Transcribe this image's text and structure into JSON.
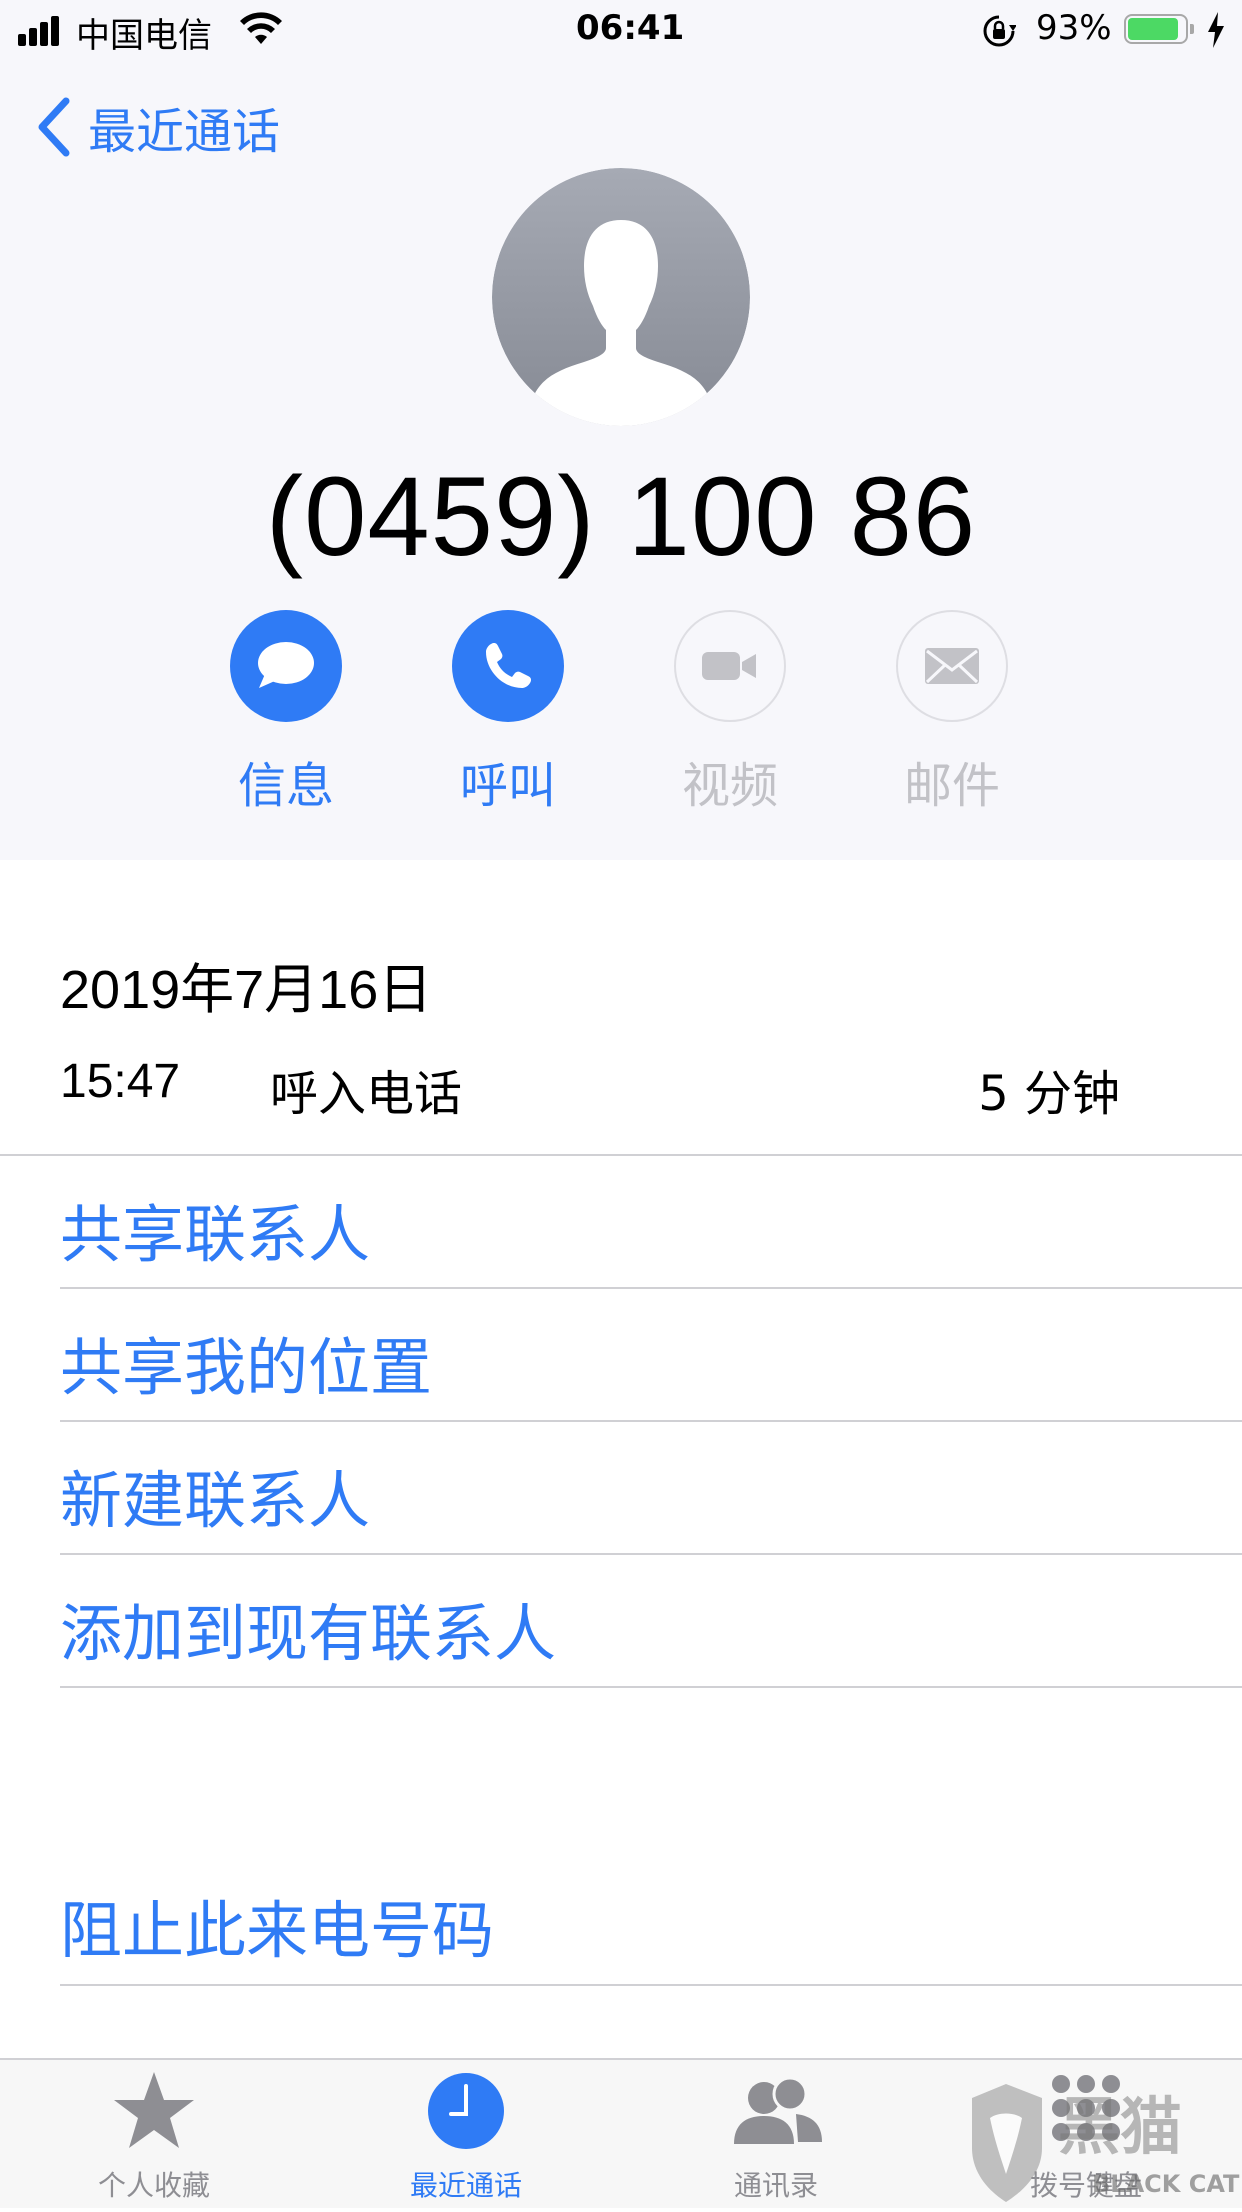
{
  "status_bar": {
    "carrier": "中国电信",
    "time": "06:41",
    "battery_percent": "93%",
    "battery_level": 0.93
  },
  "header": {
    "back_label": "最近通话",
    "phone_number": "(0459) 100 86",
    "actions": [
      {
        "label": "信息",
        "icon": "message-icon",
        "enabled": true
      },
      {
        "label": "呼叫",
        "icon": "phone-icon",
        "enabled": true
      },
      {
        "label": "视频",
        "icon": "video-icon",
        "enabled": false
      },
      {
        "label": "邮件",
        "icon": "mail-icon",
        "enabled": false
      }
    ]
  },
  "call_log": {
    "date": "2019年7月16日",
    "time": "15:47",
    "type": "呼入电话",
    "duration": "5 分钟"
  },
  "menu": {
    "share_contact": "共享联系人",
    "share_location": "共享我的位置",
    "new_contact": "新建联系人",
    "add_existing": "添加到现有联系人",
    "block": "阻止此来电号码"
  },
  "tabbar": {
    "tabs": [
      {
        "label": "个人收藏",
        "icon": "star-icon"
      },
      {
        "label": "最近通话",
        "icon": "clock-icon",
        "selected": true
      },
      {
        "label": "通讯录",
        "icon": "contacts-icon"
      },
      {
        "label": "拨号键盘",
        "icon": "keypad-icon"
      }
    ]
  },
  "watermark": {
    "text": "BLACK CAT",
    "logo_text": "黑猫"
  },
  "colors": {
    "accent": "#2f7bf5",
    "disabled": "#c2c2c7",
    "header_bg": "#f7f7fb"
  }
}
